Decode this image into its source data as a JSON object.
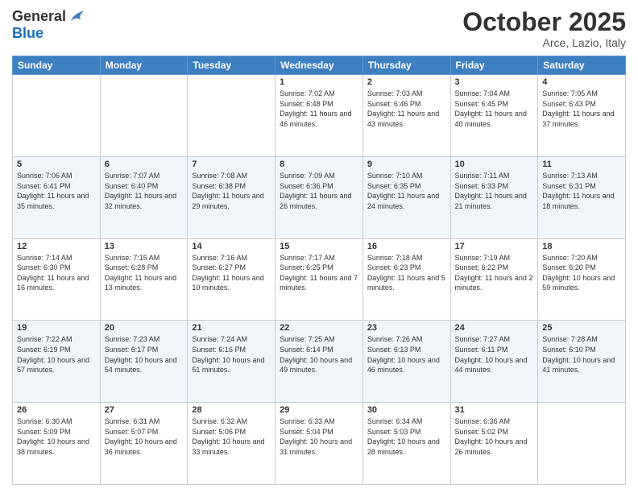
{
  "logo": {
    "general": "General",
    "blue": "Blue"
  },
  "title": "October 2025",
  "location": "Arce, Lazio, Italy",
  "days_of_week": [
    "Sunday",
    "Monday",
    "Tuesday",
    "Wednesday",
    "Thursday",
    "Friday",
    "Saturday"
  ],
  "weeks": [
    [
      null,
      null,
      null,
      {
        "day": 1,
        "sunrise": "7:02 AM",
        "sunset": "6:48 PM",
        "daylight": "11 hours and 46 minutes."
      },
      {
        "day": 2,
        "sunrise": "7:03 AM",
        "sunset": "6:46 PM",
        "daylight": "11 hours and 43 minutes."
      },
      {
        "day": 3,
        "sunrise": "7:04 AM",
        "sunset": "6:45 PM",
        "daylight": "11 hours and 40 minutes."
      },
      {
        "day": 4,
        "sunrise": "7:05 AM",
        "sunset": "6:43 PM",
        "daylight": "11 hours and 37 minutes."
      }
    ],
    [
      {
        "day": 5,
        "sunrise": "7:06 AM",
        "sunset": "6:41 PM",
        "daylight": "11 hours and 35 minutes."
      },
      {
        "day": 6,
        "sunrise": "7:07 AM",
        "sunset": "6:40 PM",
        "daylight": "11 hours and 32 minutes."
      },
      {
        "day": 7,
        "sunrise": "7:08 AM",
        "sunset": "6:38 PM",
        "daylight": "11 hours and 29 minutes."
      },
      {
        "day": 8,
        "sunrise": "7:09 AM",
        "sunset": "6:36 PM",
        "daylight": "11 hours and 26 minutes."
      },
      {
        "day": 9,
        "sunrise": "7:10 AM",
        "sunset": "6:35 PM",
        "daylight": "11 hours and 24 minutes."
      },
      {
        "day": 10,
        "sunrise": "7:11 AM",
        "sunset": "6:33 PM",
        "daylight": "11 hours and 21 minutes."
      },
      {
        "day": 11,
        "sunrise": "7:13 AM",
        "sunset": "6:31 PM",
        "daylight": "11 hours and 18 minutes."
      }
    ],
    [
      {
        "day": 12,
        "sunrise": "7:14 AM",
        "sunset": "6:30 PM",
        "daylight": "11 hours and 16 minutes."
      },
      {
        "day": 13,
        "sunrise": "7:15 AM",
        "sunset": "6:28 PM",
        "daylight": "11 hours and 13 minutes."
      },
      {
        "day": 14,
        "sunrise": "7:16 AM",
        "sunset": "6:27 PM",
        "daylight": "11 hours and 10 minutes."
      },
      {
        "day": 15,
        "sunrise": "7:17 AM",
        "sunset": "6:25 PM",
        "daylight": "11 hours and 7 minutes."
      },
      {
        "day": 16,
        "sunrise": "7:18 AM",
        "sunset": "6:23 PM",
        "daylight": "11 hours and 5 minutes."
      },
      {
        "day": 17,
        "sunrise": "7:19 AM",
        "sunset": "6:22 PM",
        "daylight": "11 hours and 2 minutes."
      },
      {
        "day": 18,
        "sunrise": "7:20 AM",
        "sunset": "6:20 PM",
        "daylight": "10 hours and 59 minutes."
      }
    ],
    [
      {
        "day": 19,
        "sunrise": "7:22 AM",
        "sunset": "6:19 PM",
        "daylight": "10 hours and 57 minutes."
      },
      {
        "day": 20,
        "sunrise": "7:23 AM",
        "sunset": "6:17 PM",
        "daylight": "10 hours and 54 minutes."
      },
      {
        "day": 21,
        "sunrise": "7:24 AM",
        "sunset": "6:16 PM",
        "daylight": "10 hours and 51 minutes."
      },
      {
        "day": 22,
        "sunrise": "7:25 AM",
        "sunset": "6:14 PM",
        "daylight": "10 hours and 49 minutes."
      },
      {
        "day": 23,
        "sunrise": "7:26 AM",
        "sunset": "6:13 PM",
        "daylight": "10 hours and 46 minutes."
      },
      {
        "day": 24,
        "sunrise": "7:27 AM",
        "sunset": "6:11 PM",
        "daylight": "10 hours and 44 minutes."
      },
      {
        "day": 25,
        "sunrise": "7:28 AM",
        "sunset": "6:10 PM",
        "daylight": "10 hours and 41 minutes."
      }
    ],
    [
      {
        "day": 26,
        "sunrise": "6:30 AM",
        "sunset": "5:09 PM",
        "daylight": "10 hours and 38 minutes."
      },
      {
        "day": 27,
        "sunrise": "6:31 AM",
        "sunset": "5:07 PM",
        "daylight": "10 hours and 36 minutes."
      },
      {
        "day": 28,
        "sunrise": "6:32 AM",
        "sunset": "5:06 PM",
        "daylight": "10 hours and 33 minutes."
      },
      {
        "day": 29,
        "sunrise": "6:33 AM",
        "sunset": "5:04 PM",
        "daylight": "10 hours and 31 minutes."
      },
      {
        "day": 30,
        "sunrise": "6:34 AM",
        "sunset": "5:03 PM",
        "daylight": "10 hours and 28 minutes."
      },
      {
        "day": 31,
        "sunrise": "6:36 AM",
        "sunset": "5:02 PM",
        "daylight": "10 hours and 26 minutes."
      },
      null
    ]
  ],
  "labels": {
    "sunrise": "Sunrise:",
    "sunset": "Sunset:",
    "daylight": "Daylight:"
  }
}
